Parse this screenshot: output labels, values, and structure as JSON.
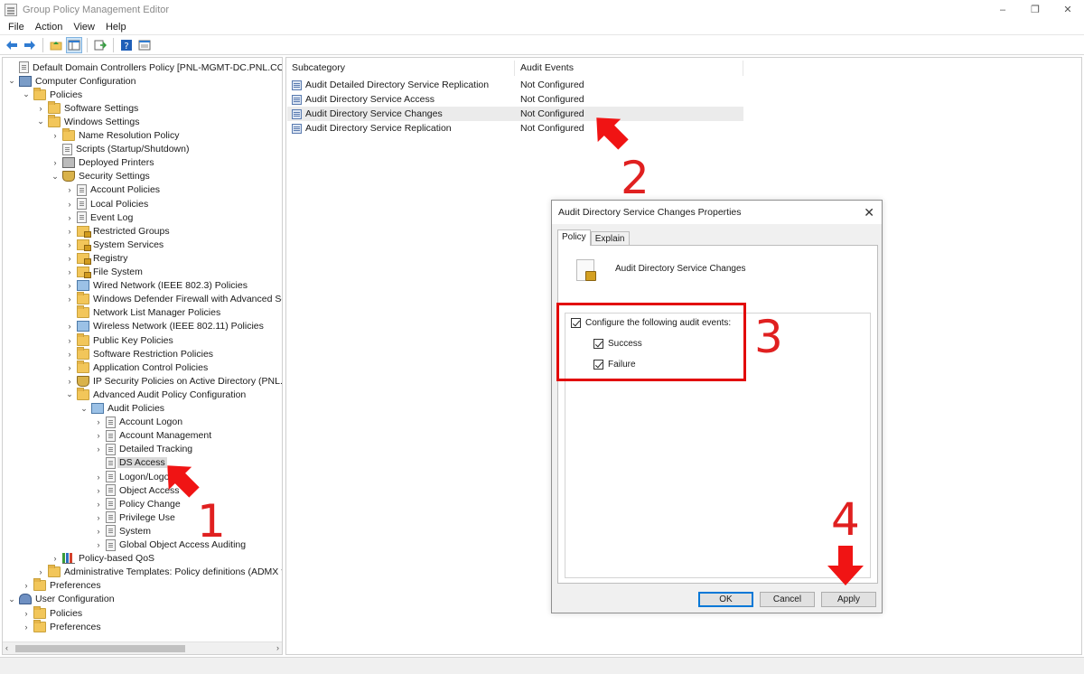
{
  "window": {
    "title": "Group Policy Management Editor",
    "controls": [
      "–",
      "❐",
      "✕"
    ]
  },
  "menu": [
    "File",
    "Action",
    "View",
    "Help"
  ],
  "tree": {
    "items": [
      {
        "label": "Default Domain Controllers Policy [PNL-MGMT-DC.PNL.COM] Policy",
        "depth": 0,
        "icon": "policy-icon",
        "twisty": ""
      },
      {
        "label": "Computer Configuration",
        "depth": 0,
        "icon": "computer-icon",
        "twisty": "expanded"
      },
      {
        "label": "Policies",
        "depth": 1,
        "icon": "folder-icon",
        "twisty": "expanded"
      },
      {
        "label": "Software Settings",
        "depth": 2,
        "icon": "folder-icon",
        "twisty": "collapsed"
      },
      {
        "label": "Windows Settings",
        "depth": 2,
        "icon": "folder-icon",
        "twisty": "expanded"
      },
      {
        "label": "Name Resolution Policy",
        "depth": 3,
        "icon": "folder-icon",
        "twisty": "collapsed"
      },
      {
        "label": "Scripts (Startup/Shutdown)",
        "depth": 3,
        "icon": "script-icon",
        "twisty": ""
      },
      {
        "label": "Deployed Printers",
        "depth": 3,
        "icon": "printer-icon",
        "twisty": "collapsed"
      },
      {
        "label": "Security Settings",
        "depth": 3,
        "icon": "security-icon",
        "twisty": "expanded"
      },
      {
        "label": "Account Policies",
        "depth": 4,
        "icon": "document-icon",
        "twisty": "collapsed"
      },
      {
        "label": "Local Policies",
        "depth": 4,
        "icon": "document-icon",
        "twisty": "collapsed"
      },
      {
        "label": "Event Log",
        "depth": 4,
        "icon": "document-icon",
        "twisty": "collapsed"
      },
      {
        "label": "Restricted Groups",
        "depth": 4,
        "icon": "locked-folder-icon",
        "twisty": "collapsed"
      },
      {
        "label": "System Services",
        "depth": 4,
        "icon": "locked-folder-icon",
        "twisty": "collapsed"
      },
      {
        "label": "Registry",
        "depth": 4,
        "icon": "locked-folder-icon",
        "twisty": "collapsed"
      },
      {
        "label": "File System",
        "depth": 4,
        "icon": "locked-folder-icon",
        "twisty": "collapsed"
      },
      {
        "label": "Wired Network (IEEE 802.3) Policies",
        "depth": 4,
        "icon": "network-icon",
        "twisty": "collapsed"
      },
      {
        "label": "Windows Defender Firewall with Advanced Security",
        "depth": 4,
        "icon": "folder-icon",
        "twisty": "collapsed"
      },
      {
        "label": "Network List Manager Policies",
        "depth": 4,
        "icon": "folder-icon",
        "twisty": ""
      },
      {
        "label": "Wireless Network (IEEE 802.11) Policies",
        "depth": 4,
        "icon": "network-icon",
        "twisty": "collapsed"
      },
      {
        "label": "Public Key Policies",
        "depth": 4,
        "icon": "folder-icon",
        "twisty": "collapsed"
      },
      {
        "label": "Software Restriction Policies",
        "depth": 4,
        "icon": "folder-icon",
        "twisty": "collapsed"
      },
      {
        "label": "Application Control Policies",
        "depth": 4,
        "icon": "folder-icon",
        "twisty": "collapsed"
      },
      {
        "label": "IP Security Policies on Active Directory (PNL.COM)",
        "depth": 4,
        "icon": "shield-icon",
        "twisty": "collapsed"
      },
      {
        "label": "Advanced Audit Policy Configuration",
        "depth": 4,
        "icon": "folder-icon",
        "twisty": "expanded"
      },
      {
        "label": "Audit Policies",
        "depth": 5,
        "icon": "audit-policies-icon",
        "twisty": "expanded"
      },
      {
        "label": "Account Logon",
        "depth": 6,
        "icon": "document-icon",
        "twisty": "collapsed"
      },
      {
        "label": "Account Management",
        "depth": 6,
        "icon": "document-icon",
        "twisty": "collapsed"
      },
      {
        "label": "Detailed Tracking",
        "depth": 6,
        "icon": "document-icon",
        "twisty": "collapsed"
      },
      {
        "label": "DS Access",
        "depth": 6,
        "icon": "document-icon",
        "twisty": "",
        "selected": true
      },
      {
        "label": "Logon/Logoff",
        "depth": 6,
        "icon": "document-icon",
        "twisty": "collapsed"
      },
      {
        "label": "Object Access",
        "depth": 6,
        "icon": "document-icon",
        "twisty": "collapsed"
      },
      {
        "label": "Policy Change",
        "depth": 6,
        "icon": "document-icon",
        "twisty": "collapsed"
      },
      {
        "label": "Privilege Use",
        "depth": 6,
        "icon": "document-icon",
        "twisty": "collapsed"
      },
      {
        "label": "System",
        "depth": 6,
        "icon": "document-icon",
        "twisty": "collapsed"
      },
      {
        "label": "Global Object Access Auditing",
        "depth": 6,
        "icon": "document-icon",
        "twisty": "collapsed"
      },
      {
        "label": "Policy-based QoS",
        "depth": 3,
        "icon": "chart-icon",
        "twisty": "collapsed"
      },
      {
        "label": "Administrative Templates: Policy definitions (ADMX files)",
        "depth": 2,
        "icon": "folder-icon",
        "twisty": "collapsed"
      },
      {
        "label": "Preferences",
        "depth": 1,
        "icon": "folder-icon",
        "twisty": "collapsed"
      },
      {
        "label": "User Configuration",
        "depth": 0,
        "icon": "user-icon",
        "twisty": "expanded"
      },
      {
        "label": "Policies",
        "depth": 1,
        "icon": "folder-icon",
        "twisty": "collapsed"
      },
      {
        "label": "Preferences",
        "depth": 1,
        "icon": "folder-icon",
        "twisty": "collapsed"
      }
    ]
  },
  "list": {
    "columns": [
      "Subcategory",
      "Audit Events"
    ],
    "rows": [
      {
        "subcategory": "Audit Detailed Directory Service Replication",
        "events": "Not Configured"
      },
      {
        "subcategory": "Audit Directory Service Access",
        "events": "Not Configured"
      },
      {
        "subcategory": "Audit Directory Service Changes",
        "events": "Not Configured",
        "hover": true
      },
      {
        "subcategory": "Audit Directory Service Replication",
        "events": "Not Configured"
      }
    ]
  },
  "dialog": {
    "title": "Audit Directory Service Changes Properties",
    "tabs": [
      "Policy",
      "Explain"
    ],
    "policy_name": "Audit Directory Service Changes",
    "configure_label": "Configure the following audit events:",
    "success_label": "Success",
    "failure_label": "Failure",
    "configure_checked": true,
    "success_checked": true,
    "failure_checked": true,
    "buttons": {
      "ok": "OK",
      "cancel": "Cancel",
      "apply": "Apply"
    }
  },
  "annotations": {
    "step1": "1",
    "step2": "2",
    "step3": "3",
    "step4": "4",
    "color": "#e20a0a"
  }
}
